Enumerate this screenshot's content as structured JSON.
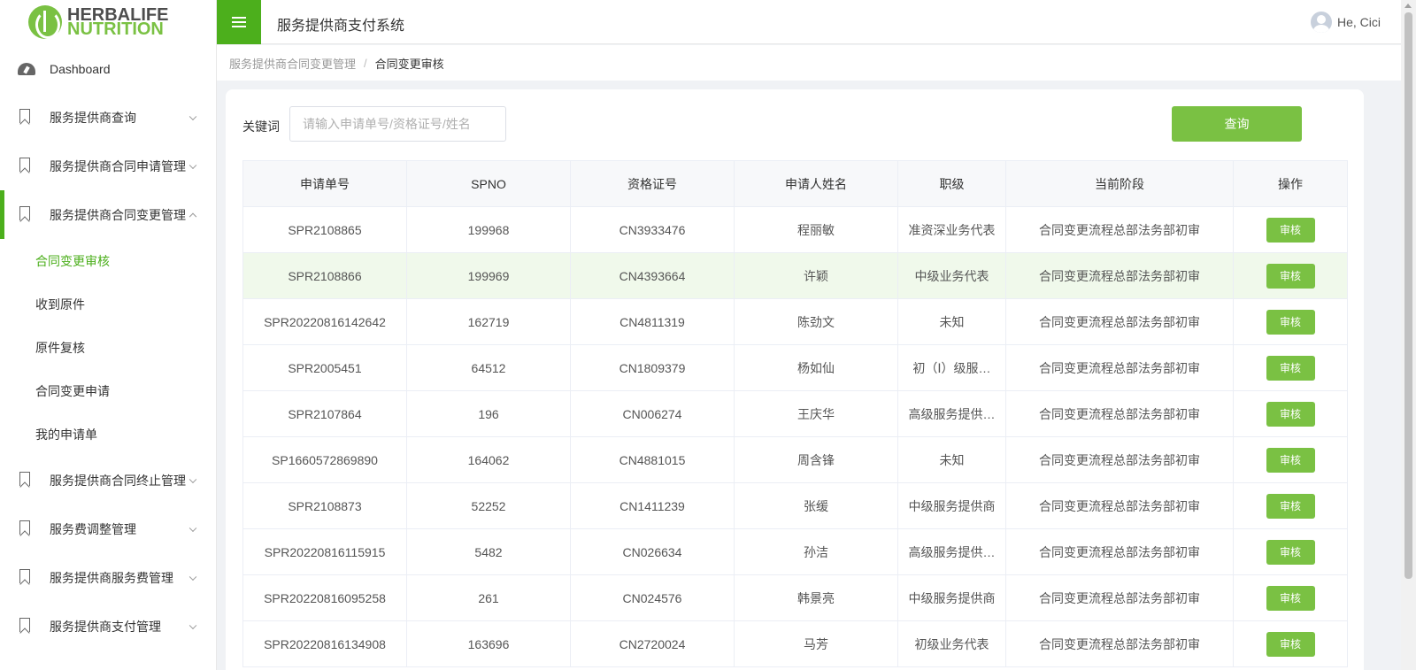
{
  "brand": {
    "line1": "HERBALIFE",
    "line2": "NUTRITION"
  },
  "header": {
    "title": "服务提供商支付系统",
    "user_greeting": "He, Cici"
  },
  "sidebar": {
    "items": [
      {
        "label": "Dashboard"
      },
      {
        "label": "服务提供商查询"
      },
      {
        "label": "服务提供商合同申请管理"
      },
      {
        "label": "服务提供商合同变更管理"
      },
      {
        "label": "服务提供商合同终止管理"
      },
      {
        "label": "服务费调整管理"
      },
      {
        "label": "服务提供商服务费管理"
      },
      {
        "label": "服务提供商支付管理"
      }
    ],
    "sub_items": [
      {
        "label": "合同变更审核"
      },
      {
        "label": "收到原件"
      },
      {
        "label": "原件复核"
      },
      {
        "label": "合同变更申请"
      },
      {
        "label": "我的申请单"
      }
    ]
  },
  "breadcrumb": {
    "parent": "服务提供商合同变更管理",
    "separator": "/",
    "current": "合同变更审核"
  },
  "search": {
    "label": "关键词",
    "placeholder": "请输入申请单号/资格证号/姓名",
    "value": "",
    "button": "查询"
  },
  "table": {
    "columns": [
      "申请单号",
      "SPNO",
      "资格证号",
      "申请人姓名",
      "职级",
      "当前阶段",
      "操作"
    ],
    "rows": [
      {
        "app_no": "SPR2108865",
        "spno": "199968",
        "cert": "CN3933476",
        "name": "程丽敏",
        "level": "准资深业务代表",
        "stage": "合同变更流程总部法务部初审",
        "action": "审核"
      },
      {
        "app_no": "SPR2108866",
        "spno": "199969",
        "cert": "CN4393664",
        "name": "许颖",
        "level": "中级业务代表",
        "stage": "合同变更流程总部法务部初审",
        "action": "审核"
      },
      {
        "app_no": "SPR20220816142642",
        "spno": "162719",
        "cert": "CN4811319",
        "name": "陈劲文",
        "level": "未知",
        "stage": "合同变更流程总部法务部初审",
        "action": "审核"
      },
      {
        "app_no": "SPR2005451",
        "spno": "64512",
        "cert": "CN1809379",
        "name": "杨如仙",
        "level": "初（Ⅰ）级服…",
        "stage": "合同变更流程总部法务部初审",
        "action": "审核"
      },
      {
        "app_no": "SPR2107864",
        "spno": "196",
        "cert": "CN006274",
        "name": "王庆华",
        "level": "高级服务提供…",
        "stage": "合同变更流程总部法务部初审",
        "action": "审核"
      },
      {
        "app_no": "SP1660572869890",
        "spno": "164062",
        "cert": "CN4881015",
        "name": "周含锋",
        "level": "未知",
        "stage": "合同变更流程总部法务部初审",
        "action": "审核"
      },
      {
        "app_no": "SPR2108873",
        "spno": "52252",
        "cert": "CN1411239",
        "name": "张缓",
        "level": "中级服务提供商",
        "stage": "合同变更流程总部法务部初审",
        "action": "审核"
      },
      {
        "app_no": "SPR20220816115915",
        "spno": "5482",
        "cert": "CN026634",
        "name": "孙洁",
        "level": "高级服务提供…",
        "stage": "合同变更流程总部法务部初审",
        "action": "审核"
      },
      {
        "app_no": "SPR20220816095258",
        "spno": "261",
        "cert": "CN024576",
        "name": "韩景亮",
        "level": "中级服务提供商",
        "stage": "合同变更流程总部法务部初审",
        "action": "审核"
      },
      {
        "app_no": "SPR20220816134908",
        "spno": "163696",
        "cert": "CN2720024",
        "name": "马芳",
        "level": "初级业务代表",
        "stage": "合同变更流程总部法务部初审",
        "action": "审核"
      }
    ]
  },
  "colors": {
    "brand_green": "#4caf1c",
    "button_green": "#7ac143",
    "link_green": "#6cb33f",
    "highlight_row": "#f0f9eb"
  }
}
